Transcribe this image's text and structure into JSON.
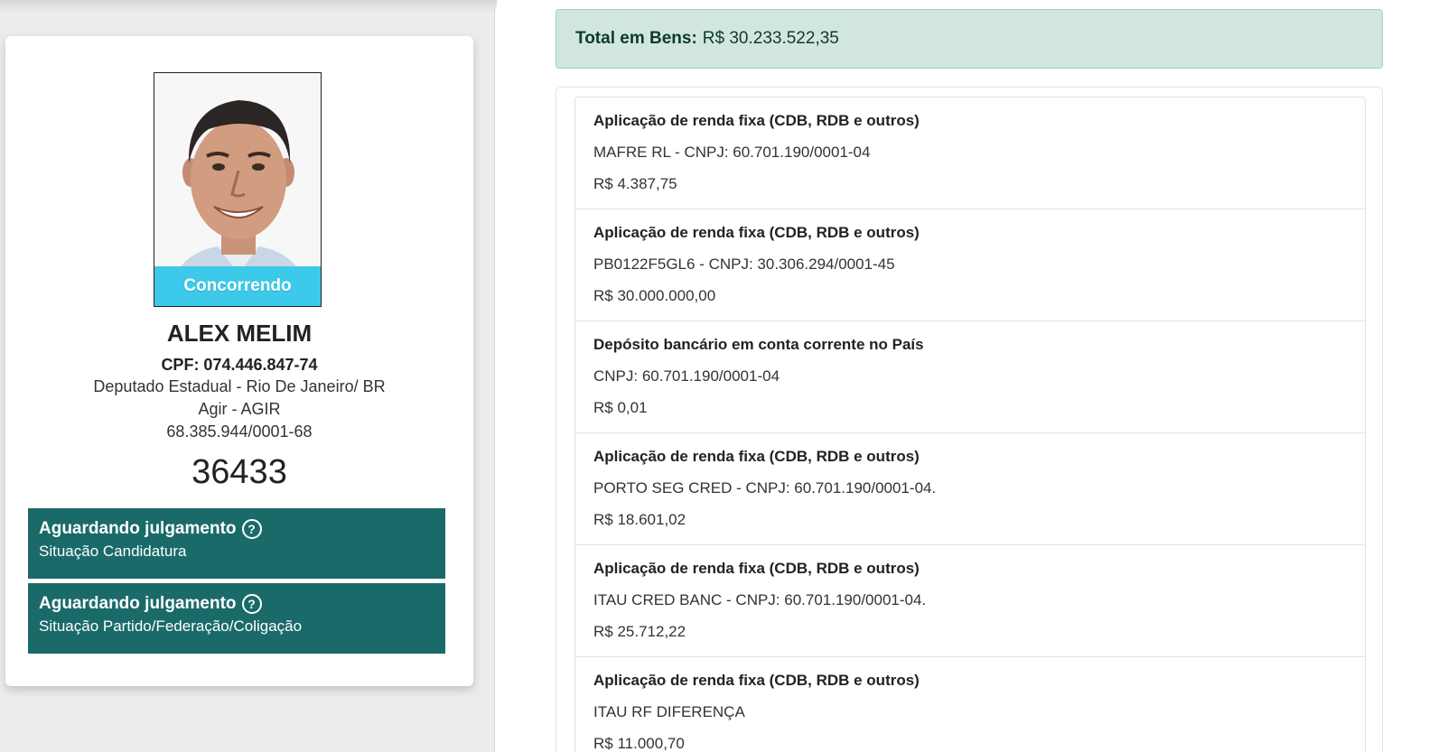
{
  "candidate": {
    "photo_status": "Concorrendo",
    "name": "ALEX MELIM",
    "cpf": "CPF: 074.446.847-74",
    "office": "Deputado Estadual - Rio De Janeiro/ BR",
    "party": "Agir - AGIR",
    "cnpj": "68.385.944/0001-68",
    "number": "36433"
  },
  "statuses": [
    {
      "title": "Aguardando julgamento",
      "subtitle": "Situação Candidatura"
    },
    {
      "title": "Aguardando julgamento",
      "subtitle": "Situação Partido/Federação/Coligação"
    }
  ],
  "total": {
    "label": "Total em Bens:",
    "value": "R$ 30.233.522,35"
  },
  "assets": [
    {
      "type": "Aplicação de renda fixa (CDB, RDB e outros)",
      "description": "MAFRE RL - CNPJ: 60.701.190/0001-04",
      "value": "R$ 4.387,75"
    },
    {
      "type": "Aplicação de renda fixa (CDB, RDB e outros)",
      "description": "PB0122F5GL6 - CNPJ: 30.306.294/0001-45",
      "value": "R$ 30.000.000,00"
    },
    {
      "type": "Depósito bancário em conta corrente no País",
      "description": "CNPJ: 60.701.190/0001-04",
      "value": "R$ 0,01"
    },
    {
      "type": "Aplicação de renda fixa (CDB, RDB e outros)",
      "description": "PORTO SEG CRED - CNPJ: 60.701.190/0001-04.",
      "value": "R$ 18.601,02"
    },
    {
      "type": "Aplicação de renda fixa (CDB, RDB e outros)",
      "description": "ITAU CRED BANC - CNPJ: 60.701.190/0001-04.",
      "value": "R$ 25.712,22"
    },
    {
      "type": "Aplicação de renda fixa (CDB, RDB e outros)",
      "description": "ITAU RF DIFERENÇA",
      "value": "R$ 11.000,70"
    }
  ],
  "colors": {
    "status_bg": "#1b6a6a",
    "badge_bg": "#3cc9ea",
    "total_bg": "#d1e7dd"
  }
}
